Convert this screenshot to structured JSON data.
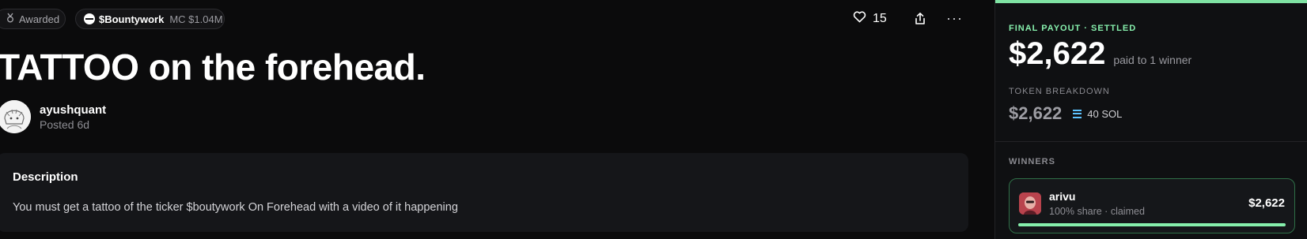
{
  "badges": {
    "awarded": "Awarded",
    "bounty_ticker": "$Bountywork",
    "bounty_mc": "MC $1.04M"
  },
  "actions": {
    "like_count": "15",
    "more_label": "···"
  },
  "post": {
    "title": "TATTOO on the forehead.",
    "author": "ayushquant",
    "posted": "Posted 6d"
  },
  "description": {
    "heading": "Description",
    "body": "You must get a tattoo of the ticker $boutywork On Forehead with a video of it happening"
  },
  "panel": {
    "payout_label": "FINAL PAYOUT · SETTLED",
    "payout_amount": "$2,622",
    "payout_sub": "paid to 1 winner",
    "breakdown_label": "TOKEN BREAKDOWN",
    "breakdown_amount": "$2,622",
    "breakdown_token": "40 SOL",
    "winners_label": "WINNERS",
    "winners": [
      {
        "name": "arivu",
        "sub": "100% share · claimed",
        "amount": "$2,622",
        "share_fraction": 1.0
      }
    ]
  },
  "colors": {
    "accent": "#86efac",
    "background": "#0b0b0c",
    "card": "#151619",
    "sol": "#5ec4ff"
  },
  "icons": {
    "awarded": "medal-icon",
    "bounty": "coin-icon",
    "like": "heart-icon",
    "share": "share-icon",
    "more": "more-icon",
    "token": "solana-icon"
  }
}
